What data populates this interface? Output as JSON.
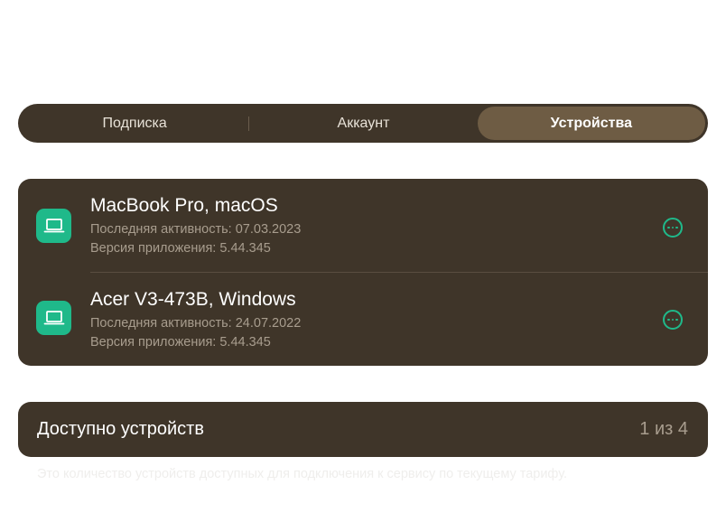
{
  "tabs": [
    {
      "label": "Подписка",
      "active": false
    },
    {
      "label": "Аккаунт",
      "active": false
    },
    {
      "label": "Устройства",
      "active": true
    }
  ],
  "devices": [
    {
      "name": "MacBook Pro, macOS",
      "last_active": "Последняя активность: 07.03.2023",
      "app_version": "Версия приложения: 5.44.345",
      "icon": "laptop-icon",
      "menu_icon": "more-options-icon"
    },
    {
      "name": "Acer V3-473B, Windows",
      "last_active": "Последняя активность: 24.07.2022",
      "app_version": "Версия приложения: 5.44.345",
      "icon": "laptop-icon",
      "menu_icon": "more-options-icon"
    }
  ],
  "available": {
    "label": "Доступно устройств",
    "value": "1 из 4"
  },
  "footnote": "Это количество устройств доступных для подключения к сервису по текущему тарифу.",
  "colors": {
    "panel": "#3f3529",
    "active_tab": "#6e5c44",
    "accent": "#1fb98a",
    "muted_text": "#a89d8e"
  }
}
